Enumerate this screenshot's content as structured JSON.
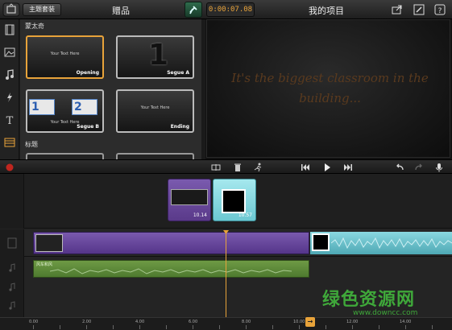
{
  "topbar": {
    "themes_button": "主题套装",
    "gift_title": "赠品",
    "timecode": "0:00:07.08",
    "project_title": "我的项目"
  },
  "browser": {
    "section_montage": "蒙太奇",
    "section_titles": "标题",
    "themes": [
      {
        "name": "Opening",
        "inner_text": "Your Text Here"
      },
      {
        "name": "Segue A",
        "inner_text": "1"
      },
      {
        "name": "Segue B",
        "inner_text": "Your Text Here",
        "numbers": [
          "1",
          "2"
        ]
      },
      {
        "name": "Ending",
        "inner_text": "Your Text Here"
      }
    ]
  },
  "preview": {
    "text": "It's the biggest classroom in the building..."
  },
  "timeline": {
    "clips": [
      {
        "label": "10.14"
      },
      {
        "label": "10.57"
      }
    ],
    "audio_clip_label": "风车和风",
    "ruler": [
      "0.00",
      "2.00",
      "4.00",
      "6.00",
      "8.00",
      "10.00",
      "12.00",
      "14.00"
    ]
  },
  "watermark": {
    "cn": "绿色资源网",
    "url": "www.downcc.com"
  },
  "colors": {
    "accent": "#e8a33a",
    "purple_clip": "#6a4a9a",
    "cyan_clip": "#7fd4dc",
    "audio_green": "#5f8a3a",
    "watermark_green": "#3fa83a"
  }
}
